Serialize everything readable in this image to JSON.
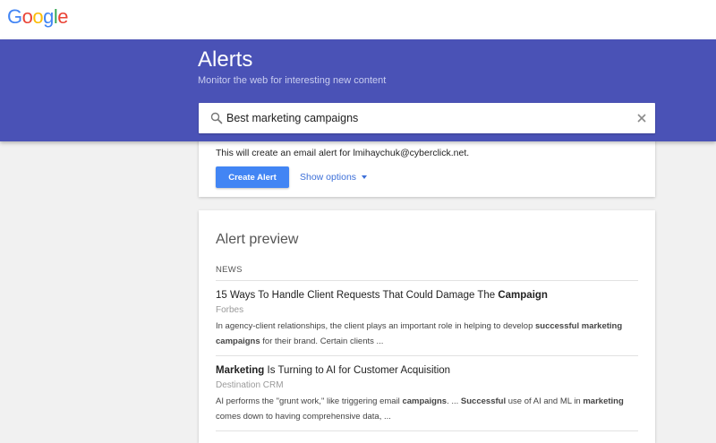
{
  "logo": {
    "letters": [
      {
        "char": "G",
        "color": "#4285f4"
      },
      {
        "char": "o",
        "color": "#ea4335"
      },
      {
        "char": "o",
        "color": "#fbbc05"
      },
      {
        "char": "g",
        "color": "#4285f4"
      },
      {
        "char": "l",
        "color": "#34a853"
      },
      {
        "char": "e",
        "color": "#ea4335"
      }
    ]
  },
  "header": {
    "title": "Alerts",
    "subtitle": "Monitor the web for interesting new content"
  },
  "search": {
    "icon": "search-icon",
    "query": "Best marketing campaigns",
    "clear_icon": "close-icon"
  },
  "create": {
    "note": "This will create an email alert for lmihaychuk@cyberclick.net.",
    "button_label": "Create Alert",
    "options_label": "Show options",
    "options_icon": "dropdown-arrow-icon"
  },
  "preview": {
    "title": "Alert preview",
    "section": "NEWS",
    "results": [
      {
        "title_parts": [
          {
            "text": "15 Ways To Handle Client Requests That Could Damage The ",
            "bold": false
          },
          {
            "text": "Campaign",
            "bold": true
          }
        ],
        "source": "Forbes",
        "snippet_lines": [
          [
            {
              "text": "In agency-client relationships, the client plays an important role in helping to develop ",
              "bold": false
            },
            {
              "text": "successful marketing",
              "bold": true
            }
          ],
          [
            {
              "text": "campaigns",
              "bold": true
            },
            {
              "text": " for their brand. Certain clients ...",
              "bold": false
            }
          ]
        ]
      },
      {
        "title_parts": [
          {
            "text": "Marketing",
            "bold": true
          },
          {
            "text": " Is Turning to AI for Customer Acquisition",
            "bold": false
          }
        ],
        "source": "Destination CRM",
        "snippet_lines": [
          [
            {
              "text": "AI performs the \"grunt work,\" like triggering email ",
              "bold": false
            },
            {
              "text": "campaigns",
              "bold": true
            },
            {
              "text": ". ... ",
              "bold": false
            },
            {
              "text": "Successful",
              "bold": true
            },
            {
              "text": " use of AI and ML in ",
              "bold": false
            },
            {
              "text": "marketing",
              "bold": true
            }
          ],
          [
            {
              "text": "comes down to having comprehensive data, ...",
              "bold": false
            }
          ]
        ]
      }
    ]
  },
  "colors": {
    "banner": "#4a52b6",
    "button": "#4285f4",
    "link": "#3c6fd8",
    "page_bg": "#f1f1f1"
  }
}
